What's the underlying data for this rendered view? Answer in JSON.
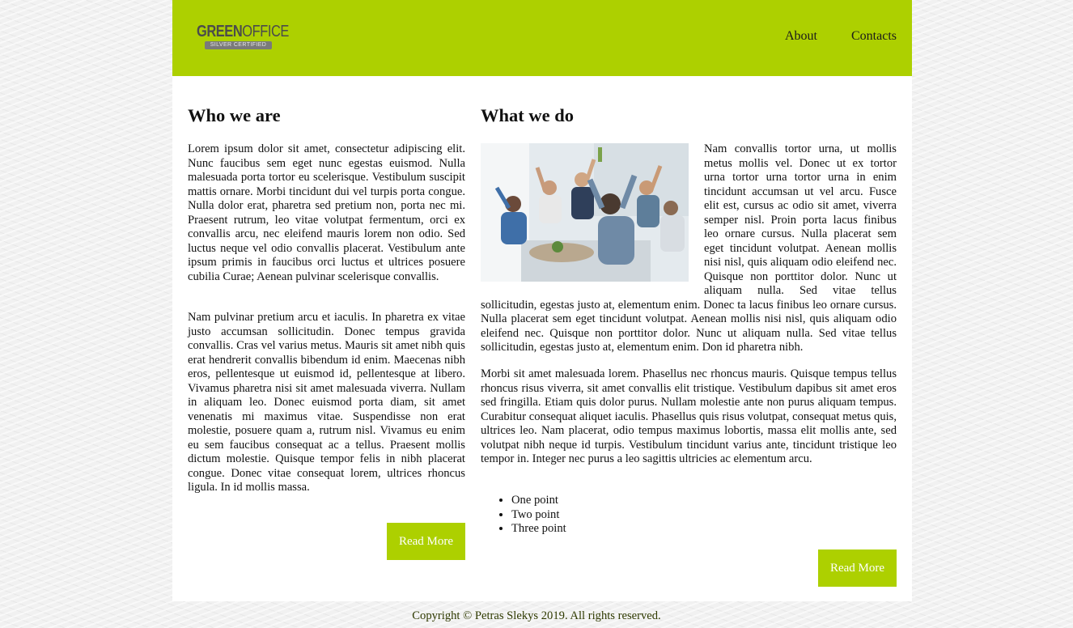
{
  "header": {
    "logo": {
      "word_bold": "GREEN",
      "word_light": "OFFICE",
      "badge": "SILVER CERTIFIED"
    },
    "nav": [
      {
        "label": "About"
      },
      {
        "label": "Contacts"
      }
    ],
    "background": "#add000"
  },
  "left_column": {
    "title": "Who we are",
    "paragraphs": [
      "Lorem ipsum dolor sit amet, consectetur adipiscing elit. Nunc faucibus sem eget nunc egestas euismod. Nulla malesuada porta tortor eu scelerisque. Vestibulum suscipit mattis ornare. Morbi tincidunt dui vel turpis porta congue. Nulla dolor erat, pharetra sed pretium non, porta nec mi. Praesent rutrum, leo vitae volutpat fermentum, orci ex convallis arcu, nec eleifend mauris lorem non odio. Sed luctus neque vel odio convallis placerat. Vestibulum ante ipsum primis in faucibus orci luctus et ultrices posuere cubilia Curae; Aenean pulvinar scelerisque convallis.",
      "Nam pulvinar pretium arcu et iaculis. In pharetra ex vitae justo accumsan sollicitudin. Donec tempus gravida convallis. Cras vel varius metus. Mauris sit amet nibh quis erat hendrerit convallis bibendum id enim. Maecenas nibh eros, pellentesque ut euismod id, pellentesque at libero. Vivamus pharetra nisi sit amet malesuada viverra. Nullam in aliquam leo. Donec euismod porta diam, sit amet venenatis mi maximus vitae. Suspendisse non erat molestie, posuere quam a, rutrum nisl. Vivamus eu enim eu sem faucibus consequat ac a tellus. Praesent mollis dictum molestie. Quisque tempor felis in nibh placerat congue. Donec vitae consequat lorem, ultrices rhoncus ligula. In id mollis massa."
    ],
    "button": "Read More"
  },
  "right_column": {
    "title": "What we do",
    "paragraphs": [
      "Nam convallis tortor urna, ut mollis metus mollis vel. Donec ut ex tortor urna tortor urna tortor urna in enim tincidunt accumsan ut vel arcu. Fusce elit est, cursus ac odio sit amet, viverra semper nisl. Proin porta lacus finibus leo ornare cursus. Nulla placerat sem eget tincidunt volutpat. Aenean mollis nisi nisl, quis aliquam odio eleifend nec. Quisque non porttitor dolor. Nunc ut aliquam nulla. Sed vitae tellus sollicitudin, egestas justo at, elementum enim. Donec ta lacus finibus leo ornare cursus. Nulla placerat sem eget tincidunt volutpat. Aenean mollis nisi nisl, quis aliquam odio eleifend nec. Quisque non porttitor dolor. Nunc ut aliquam nulla. Sed vitae tellus sollicitudin, egestas justo at, elementum enim. Don id pharetra nibh.",
      "Morbi sit amet malesuada lorem. Phasellus nec rhoncus mauris. Quisque tempus tellus rhoncus risus viverra, sit amet convallis elit tristique. Vestibulum dapibus sit amet eros sed fringilla. Etiam quis dolor purus. Nullam molestie ante non purus aliquam tempus. Curabitur consequat aliquet iaculis. Phasellus quis risus volutpat, consequat metus quis, ultrices leo. Nam placerat, odio tempus maximus lobortis, massa elit mollis ante, sed volutpat nibh neque id turpis. Vestibulum tincidunt varius ante, tincidunt tristique leo tempor in. Integer nec purus a leo sagittis ultricies ac elementum arcu."
    ],
    "list": [
      "One point",
      "Two point",
      "Three point"
    ],
    "button": "Read More"
  },
  "footer": {
    "text": "Copyright © Petras Slekys 2019. All rights reserved."
  }
}
